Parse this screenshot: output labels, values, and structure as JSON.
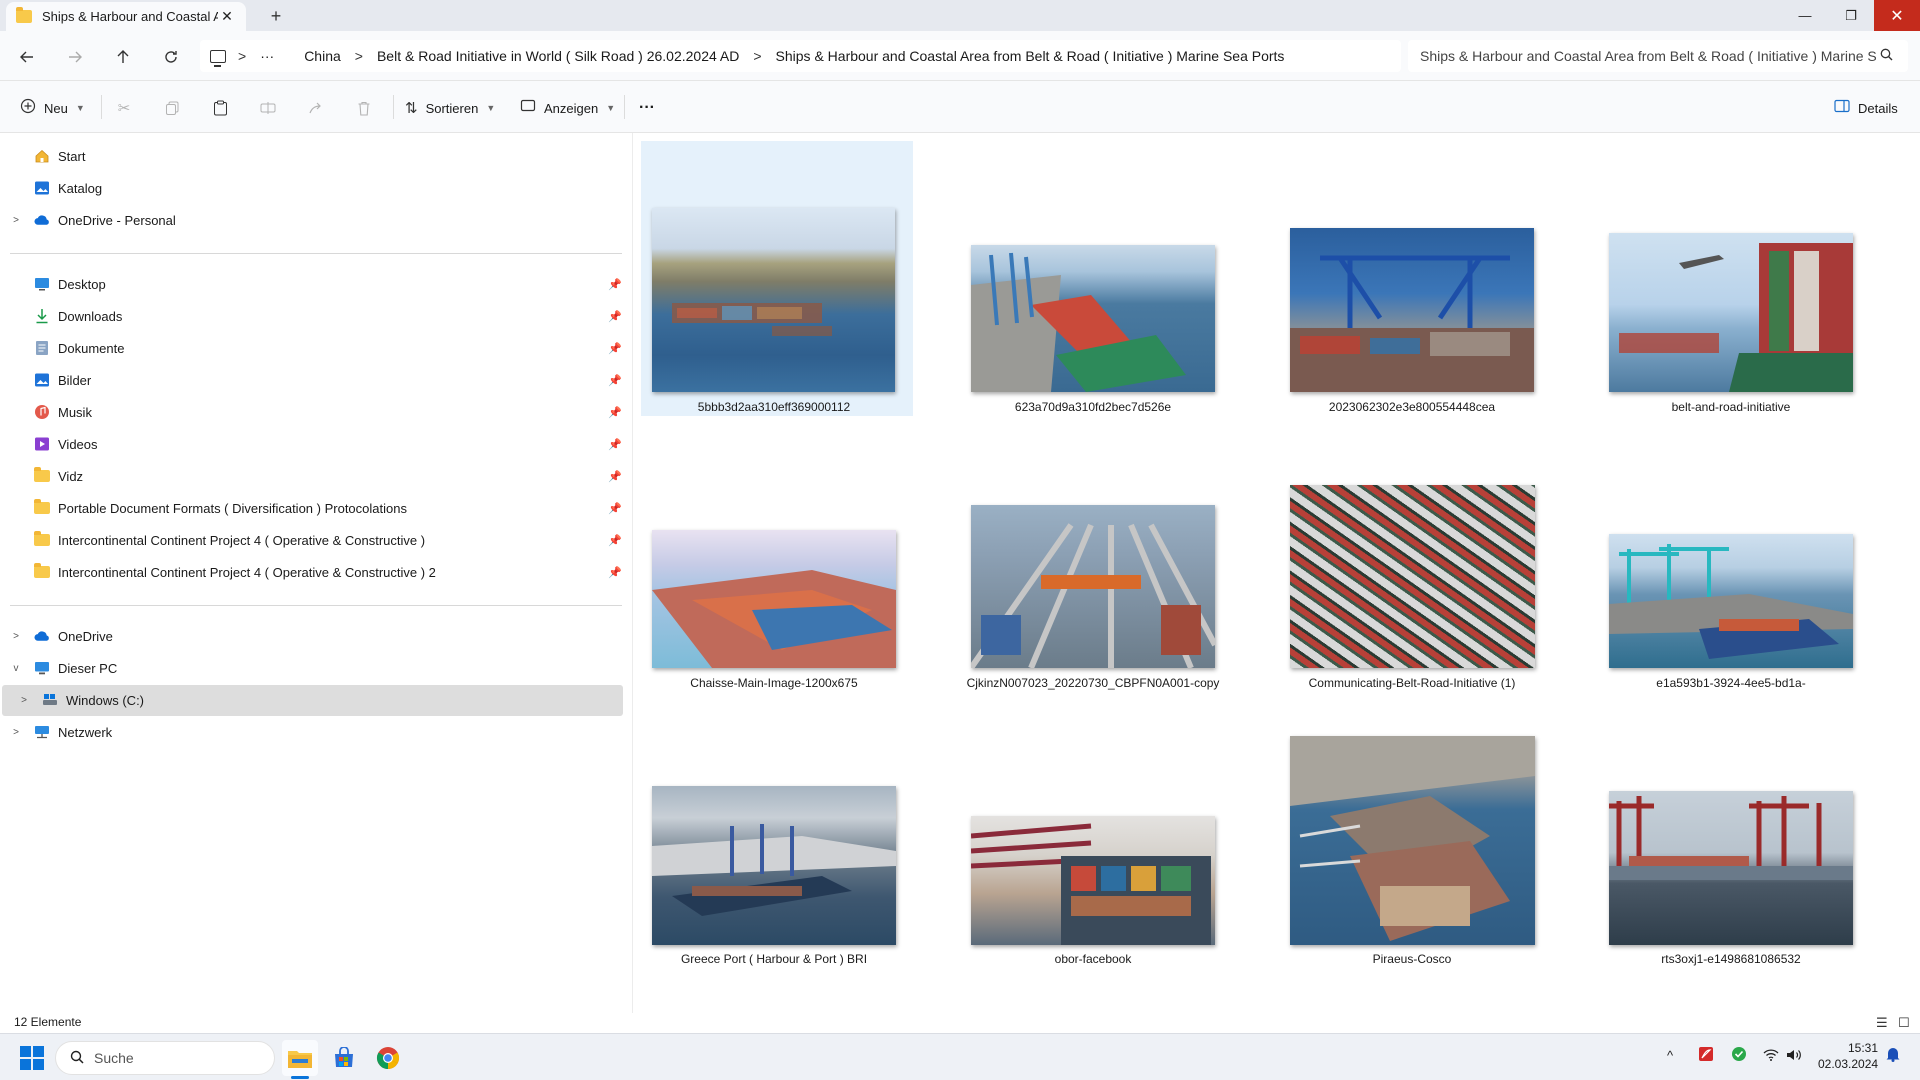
{
  "window": {
    "tab_title": "Ships & Harbour and Coastal A",
    "new_tab": "+",
    "minimize": "—",
    "maximize": "❐",
    "close": "✕",
    "tab_close": "✕"
  },
  "address": {
    "overflow": "···",
    "crumbs": [
      "China",
      "Belt & Road Initiative in World ( Silk Road ) 26.02.2024 AD",
      "Ships & Harbour and Coastal Area  from Belt & Road ( Initiative ) Marine Sea Ports"
    ],
    "separator": ">",
    "search_value": "Ships & Harbour and Coastal Area  from Belt & Road ( Initiative ) Marine Sea Ports"
  },
  "toolbar": {
    "new_label": "Neu",
    "sort_label": "Sortieren",
    "view_label": "Anzeigen",
    "more_label": "···",
    "details_label": "Details"
  },
  "nav": {
    "top": [
      {
        "label": "Start",
        "icon": "home-icon"
      },
      {
        "label": "Katalog",
        "icon": "gallery-icon"
      },
      {
        "label": "OneDrive - Personal",
        "icon": "cloud-icon"
      }
    ],
    "quick": [
      {
        "label": "Desktop",
        "icon": "desktop-icon"
      },
      {
        "label": "Downloads",
        "icon": "download-icon"
      },
      {
        "label": "Dokumente",
        "icon": "documents-icon"
      },
      {
        "label": "Bilder",
        "icon": "pictures-icon"
      },
      {
        "label": "Musik",
        "icon": "music-icon"
      },
      {
        "label": "Videos",
        "icon": "videos-icon"
      },
      {
        "label": "Vidz",
        "icon": "folder-icon"
      },
      {
        "label": "Portable Document Formats ( Diversification ) Protocolations",
        "icon": "folder-icon"
      },
      {
        "label": "Intercontinental Continent Project 4 ( Operative & Constructive )",
        "icon": "folder-icon"
      },
      {
        "label": "Intercontinental Continent Project 4 ( Operative & Constructive ) 2",
        "icon": "folder-icon"
      }
    ],
    "bottom": [
      {
        "label": "OneDrive",
        "icon": "cloud-icon"
      },
      {
        "label": "Dieser PC",
        "icon": "pc-icon"
      },
      {
        "label": "Windows (C:)",
        "icon": "drive-icon"
      },
      {
        "label": "Netzwerk",
        "icon": "network-icon"
      }
    ]
  },
  "files": [
    {
      "name": "5bbb3d2aa310eff369000112"
    },
    {
      "name": "623a70d9a310fd2bec7d526e"
    },
    {
      "name": "2023062302e3e800554448cea"
    },
    {
      "name": "belt-and-road-initiative"
    },
    {
      "name": "Chaisse-Main-Image-1200x675"
    },
    {
      "name": "CjkinzN007023_20220730_CBPFN0A001-copy"
    },
    {
      "name": "Communicating-Belt-Road-Initiative (1)"
    },
    {
      "name": "e1a593b1-3924-4ee5-bd1a-"
    },
    {
      "name": "Greece Port ( Harbour & Port ) BRI"
    },
    {
      "name": "obor-facebook"
    },
    {
      "name": "Piraeus-Cosco"
    },
    {
      "name": "rts3oxj1-e1498681086532"
    }
  ],
  "status": {
    "count": "12 Elemente"
  },
  "taskbar": {
    "search_placeholder": "Suche",
    "time": "15:31",
    "date": "02.03.2024"
  },
  "colors": {
    "accent": "#0a74da",
    "selection": "#e5f1fb",
    "close_red": "#c42b1c"
  }
}
